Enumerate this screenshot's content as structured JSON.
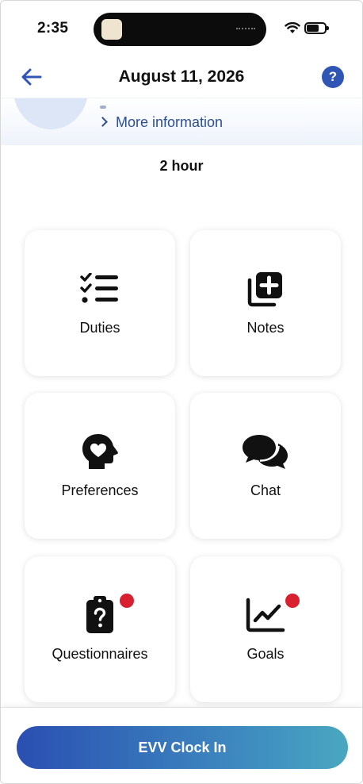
{
  "status_bar": {
    "time": "2:35"
  },
  "header": {
    "title": "August 11, 2026",
    "help_label": "?"
  },
  "client": {
    "more_info_label": "More information"
  },
  "visit": {
    "duration": "2 hour"
  },
  "tiles": [
    {
      "label": "Duties",
      "icon": "checklist-icon",
      "has_badge": false
    },
    {
      "label": "Notes",
      "icon": "notes-add-icon",
      "has_badge": false
    },
    {
      "label": "Preferences",
      "icon": "head-heart-icon",
      "has_badge": false
    },
    {
      "label": "Chat",
      "icon": "chat-bubbles-icon",
      "has_badge": false
    },
    {
      "label": "Questionnaires",
      "icon": "clipboard-question-icon",
      "has_badge": true
    },
    {
      "label": "Goals",
      "icon": "line-chart-icon",
      "has_badge": true
    }
  ],
  "footer": {
    "clock_in_label": "EVV Clock In"
  },
  "colors": {
    "accent": "#2f55b5",
    "badge": "#d92030",
    "button_start": "#2a4fb1",
    "button_end": "#4aa7bf"
  }
}
